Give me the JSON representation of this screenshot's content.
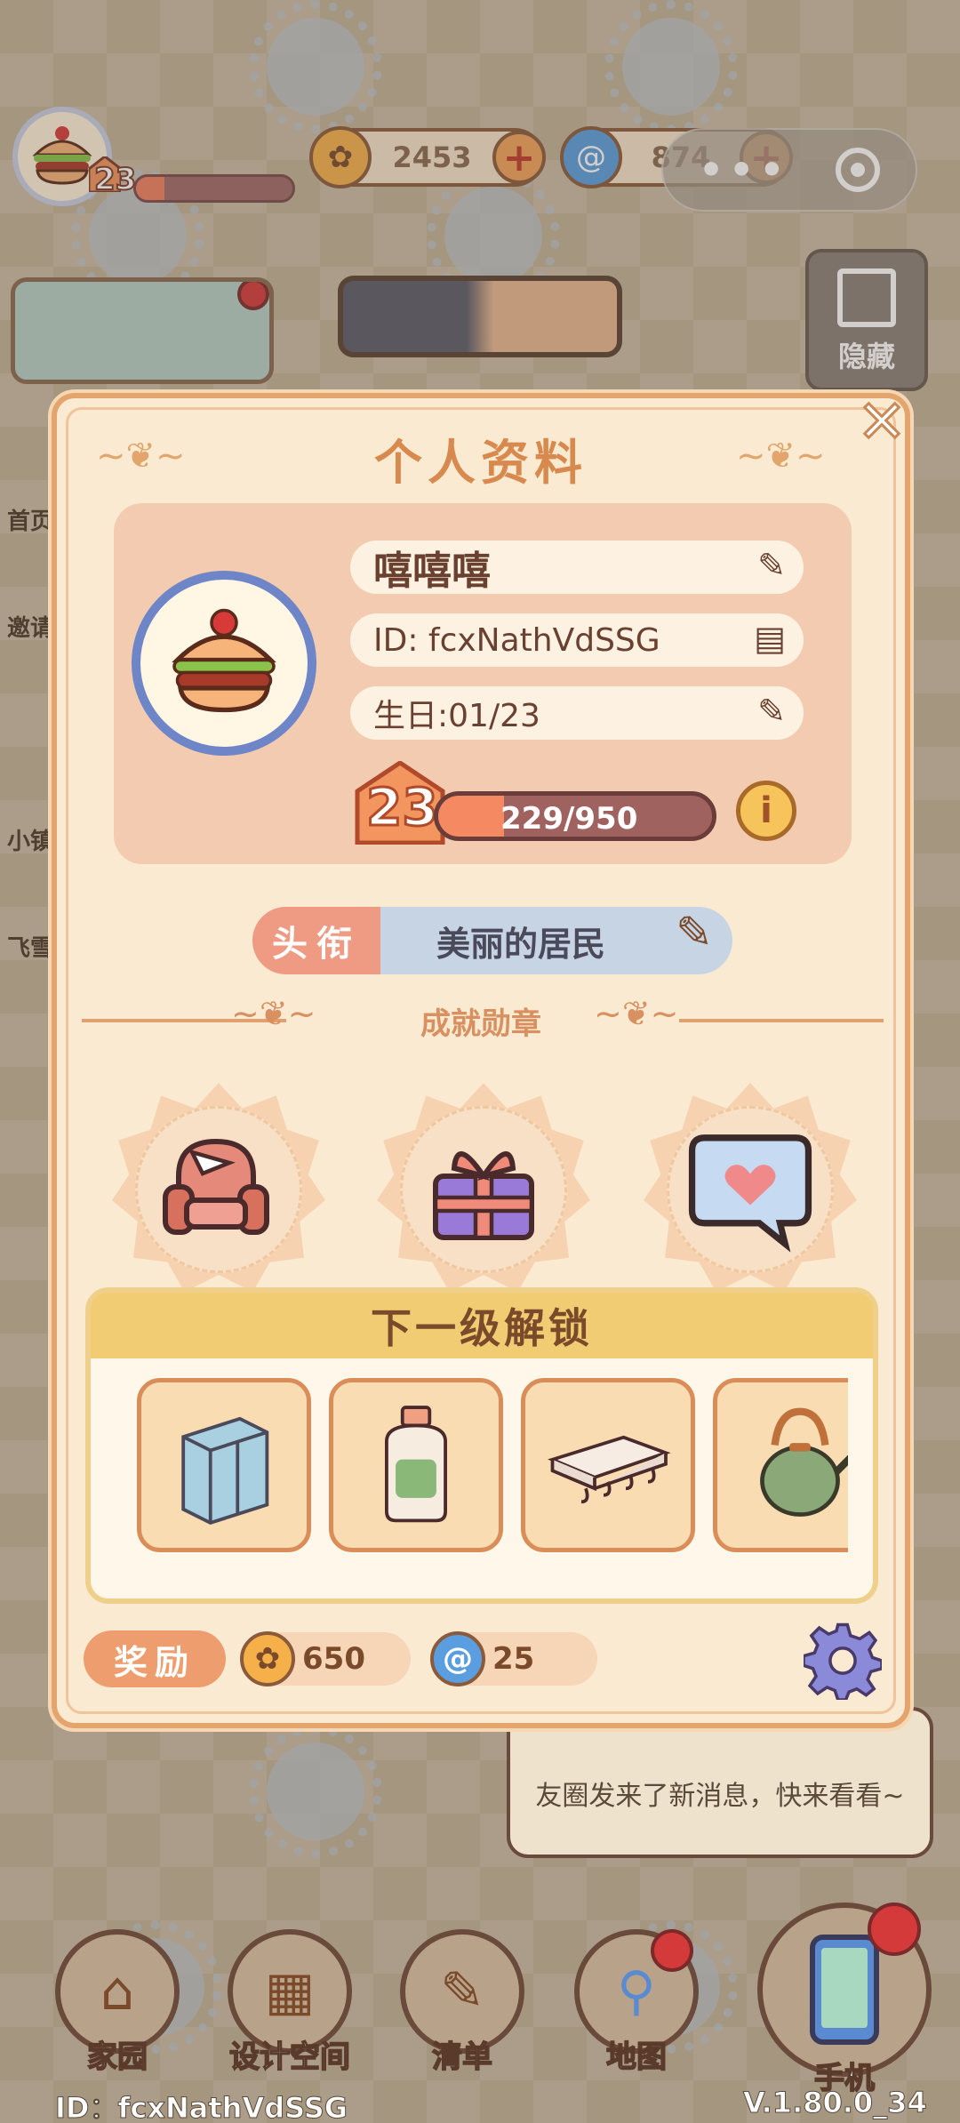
{
  "hud": {
    "level": "23",
    "coins": "2453",
    "gems": "874"
  },
  "side": {
    "hide_label": "隐藏",
    "items": [
      "首页",
      "邀请",
      "小镇",
      "飞雪"
    ]
  },
  "dialog": {
    "title": "个人资料",
    "name": "嘻嘻嘻",
    "id_text": "ID: fcxNathVdSSG",
    "birthday_text": "生日:01/23",
    "level": "23",
    "xp_text": "229/950",
    "xp_fraction": 0.241,
    "title_tag": "头衔",
    "title_value": "美丽的居民",
    "achievements_label": "成就勋章",
    "unlock_label": "下一级解锁",
    "reward_label": "奖励",
    "reward_coins": "650",
    "reward_gems": "25"
  },
  "notification": {
    "message": "友圈发来了新消息，快来看看~"
  },
  "nav": {
    "home": "家园",
    "design": "设计空间",
    "list": "清单",
    "map": "地图",
    "phone": "手机"
  },
  "footer": {
    "id": "ID：fcxNathVdSSG",
    "version": "V.1.80.0_34"
  },
  "colors": {
    "accent": "#e4a46e",
    "xp_fill": "#f58a62",
    "badge_dot": "#d43a3a"
  }
}
